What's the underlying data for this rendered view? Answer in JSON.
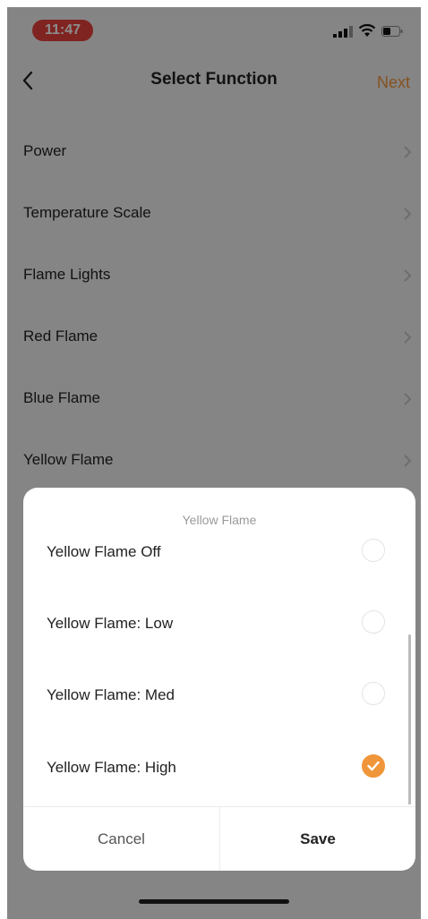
{
  "status_bar": {
    "time": "11:47",
    "icons": [
      "signal-icon",
      "wifi-icon",
      "battery-icon"
    ],
    "time_pill_color": "#e8433c"
  },
  "nav": {
    "back_icon": "chevron-left-icon",
    "title": "Select Function",
    "next_label": "Next",
    "accent_color": "#f0963a"
  },
  "functions": [
    {
      "label": "Power"
    },
    {
      "label": "Temperature Scale"
    },
    {
      "label": "Flame Lights"
    },
    {
      "label": "Red Flame"
    },
    {
      "label": "Blue Flame"
    },
    {
      "label": "Yellow Flame"
    }
  ],
  "sheet": {
    "title": "Yellow Flame",
    "options": [
      {
        "label": "Yellow Flame Off",
        "selected": false
      },
      {
        "label": "Yellow Flame: Low",
        "selected": false
      },
      {
        "label": "Yellow Flame: Med",
        "selected": false
      },
      {
        "label": "Yellow Flame: High",
        "selected": true
      }
    ],
    "cancel_label": "Cancel",
    "save_label": "Save"
  }
}
